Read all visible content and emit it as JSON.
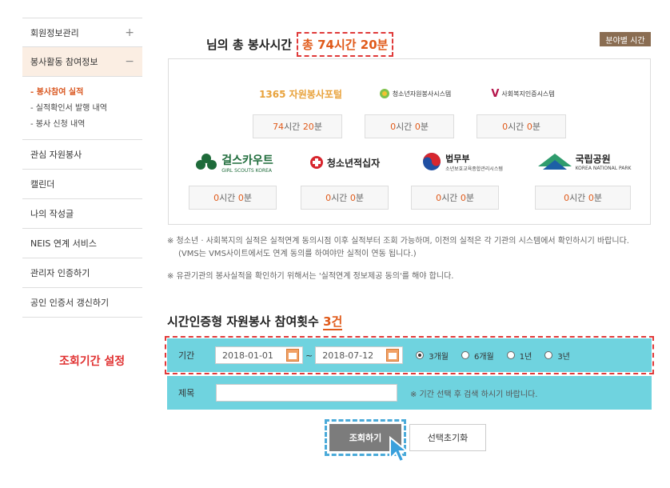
{
  "sidebar": {
    "items": [
      {
        "label": "회원정보관리",
        "toggle": "+"
      },
      {
        "label": "봉사활동 참여정보",
        "toggle": "−"
      },
      {
        "label": "관심 자원봉사"
      },
      {
        "label": "캘린더"
      },
      {
        "label": "나의 작성글"
      },
      {
        "label": "NEIS 연계 서비스"
      },
      {
        "label": "관리자 인증하기"
      },
      {
        "label": "공인 인증서 갱신하기"
      }
    ],
    "subitems": [
      "- 봉사참여 실적",
      "- 실적확인서 발행 내역",
      "- 봉사 신청 내역"
    ]
  },
  "summary": {
    "title": "님의 총 봉사시간",
    "total": "총 74시간 20분",
    "field_button": "분야별 시간"
  },
  "systems": [
    {
      "name": "1365 자원봉사포털",
      "hours_num": "74",
      "hours_unit": "시간",
      "min_num": "20",
      "min_unit": "분"
    },
    {
      "name": "청소년자원봉사시스템",
      "hours_num": "0",
      "hours_unit": "시간",
      "min_num": "0",
      "min_unit": "분"
    },
    {
      "name": "사회복지인증시스템",
      "hours_num": "0",
      "hours_unit": "시간",
      "min_num": "0",
      "min_unit": "분"
    },
    {
      "name": "걸스카우트",
      "sub": "GIRL SCOUTS KOREA",
      "hours_num": "0",
      "hours_unit": "시간",
      "min_num": "0",
      "min_unit": "분"
    },
    {
      "name": "청소년적십자",
      "hours_num": "0",
      "hours_unit": "시간",
      "min_num": "0",
      "min_unit": "분"
    },
    {
      "name": "법무부",
      "sub": "소년보호교육종합관리시스템",
      "hours_num": "0",
      "hours_unit": "시간",
      "min_num": "0",
      "min_unit": "분"
    },
    {
      "name": "국립공원",
      "sub": "KOREA NATIONAL PARK",
      "hours_num": "0",
      "hours_unit": "시간",
      "min_num": "0",
      "min_unit": "분"
    }
  ],
  "notes": [
    "※ 청소년 · 사회복지의 실적은 실적연계 동의시점 이후 실적부터 조회 가능하며, 이전의 실적은 각 기관의 시스템에서 확인하시기 바랍니다.",
    "(VMS는 VMS사이트에서도 연계 동의를 하여야만 실적이 연동 됩니다.)",
    "※ 유관기관의 봉사실적을 확인하기 위해서는 '실적연계 정보제공 동의'를 해야 합니다."
  ],
  "section": {
    "title": "시간인증형 자원봉사 참여횟수",
    "count": "3건"
  },
  "annotation": "조회기간 설정",
  "search": {
    "period_label": "기간",
    "start_date": "2018-01-01",
    "tilde": "~",
    "end_date": "2018-07-12",
    "options": [
      "3개월",
      "6개월",
      "1년",
      "3년"
    ],
    "selected_option": "3개월",
    "title_label": "제목",
    "title_value": "",
    "hint": "※ 기간 선택 후 검색 하시기 바랍니다."
  },
  "buttons": {
    "search": "조회하기",
    "reset": "선택초기화"
  },
  "colors": {
    "accent": "#e05a1a",
    "search_bg": "#6fd3df",
    "active_bg": "#fbeee3",
    "annotation_red": "#e03030"
  }
}
